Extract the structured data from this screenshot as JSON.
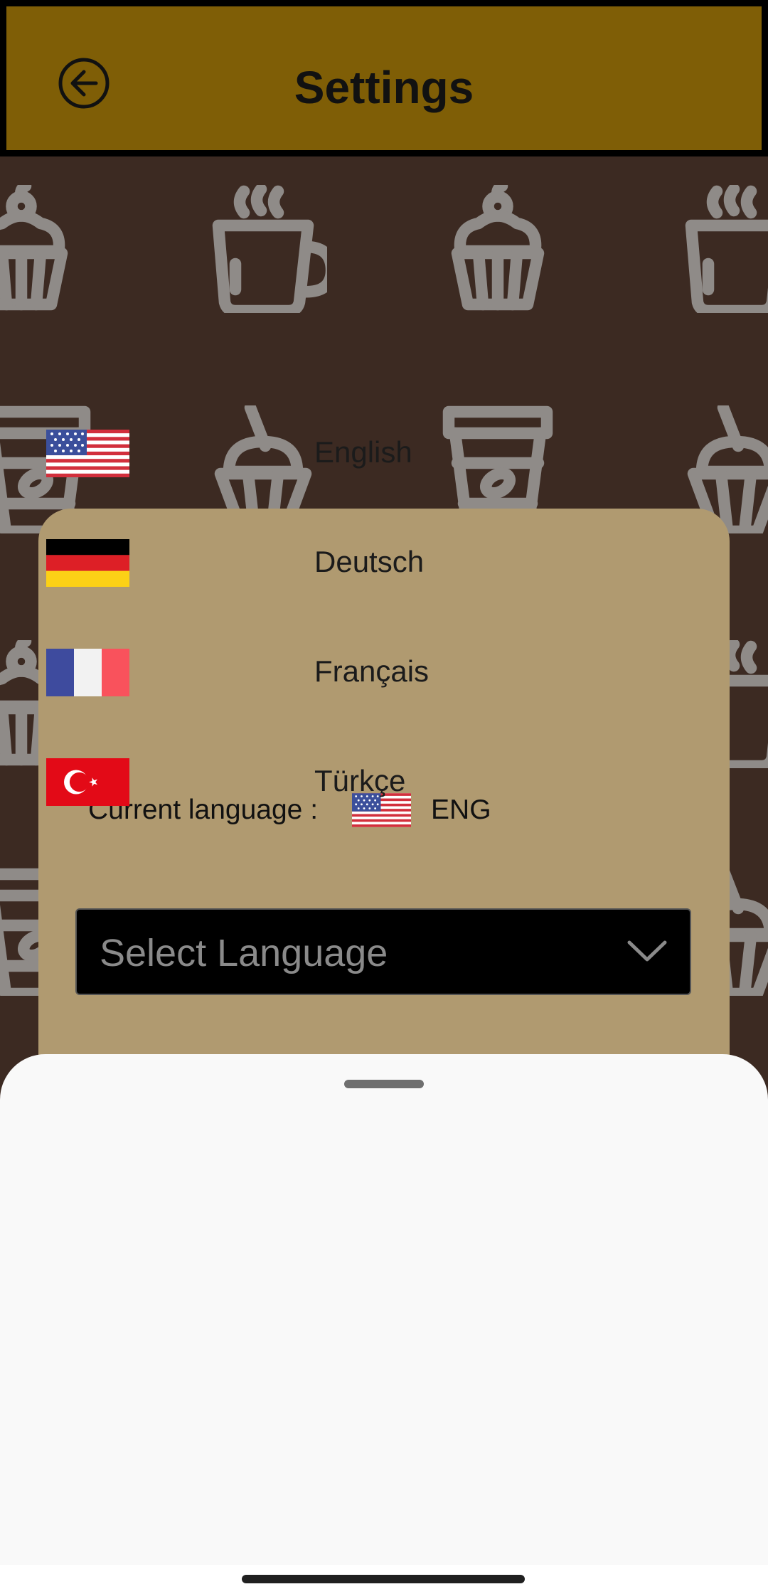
{
  "app_bar": {
    "title": "Settings",
    "back_icon": "arrow-left-circle-icon",
    "background": "#7f5e06"
  },
  "background_pattern": {
    "icons": [
      "cupcake-icon",
      "coffee-mug-icon",
      "takeaway-cup-icon",
      "ice-cream-drink-icon",
      "coffee-bean-icon"
    ],
    "background": "#3c2a22"
  },
  "language_card": {
    "current_label": "Current language :",
    "current_flag": "us-flag-icon",
    "current_code": "ENG",
    "select": {
      "placeholder": "Select Language",
      "chevron_icon": "chevron-down-icon"
    },
    "background": "#b09a70"
  },
  "language_sheet": {
    "options": [
      {
        "label": "English",
        "flag": "us-flag-icon"
      },
      {
        "label": "Deutsch",
        "flag": "germany-flag-icon"
      },
      {
        "label": "Français",
        "flag": "france-flag-icon"
      },
      {
        "label": "Türkçe",
        "flag": "turkey-flag-icon"
      }
    ]
  }
}
